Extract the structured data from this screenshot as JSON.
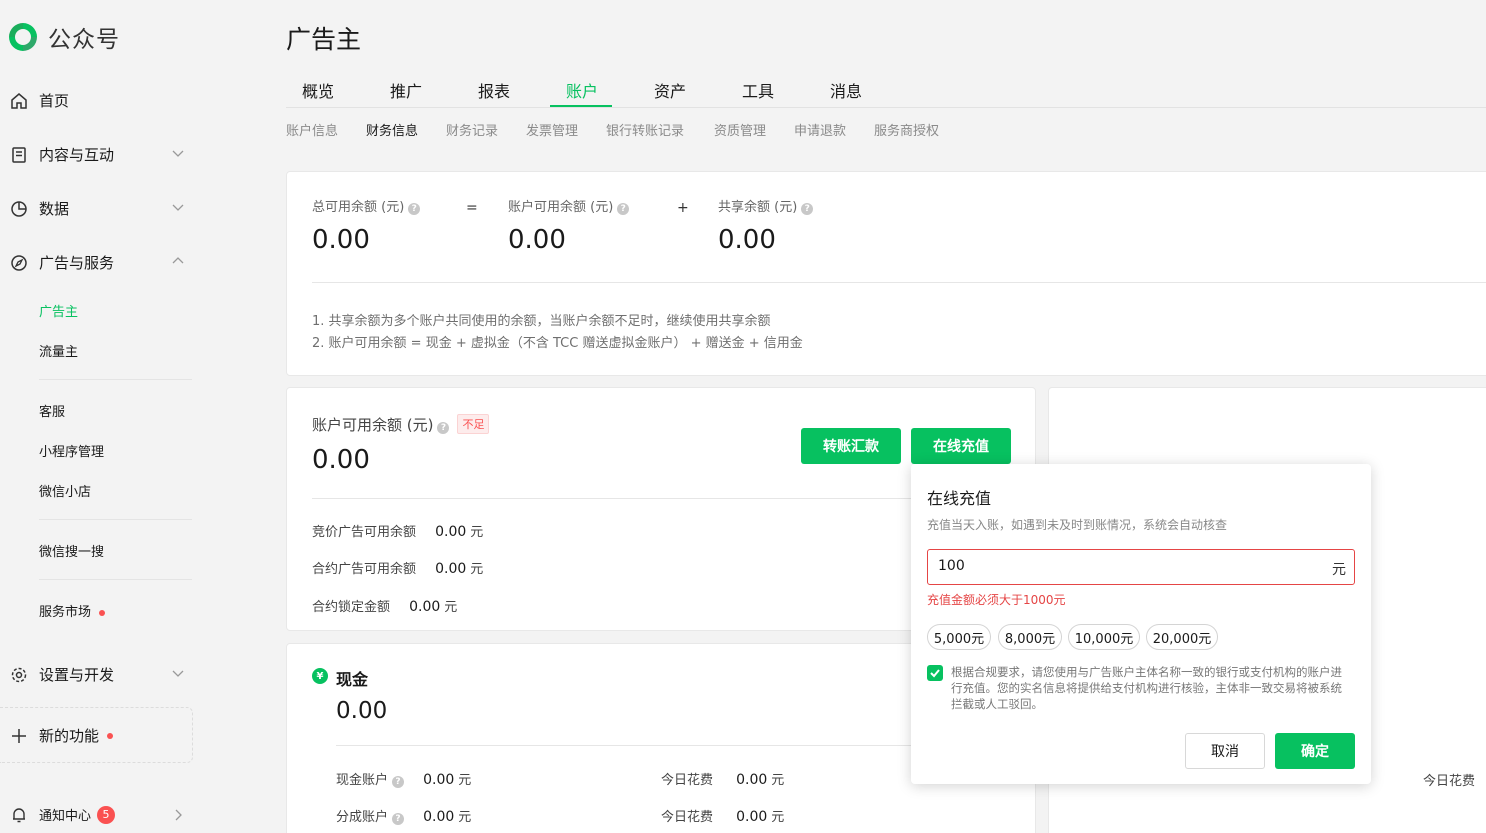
{
  "sidebar": {
    "logo_text": "公众号",
    "items": {
      "home": "首页",
      "content": "内容与互动",
      "data": "数据",
      "ads": "广告与服务",
      "settings": "设置与开发",
      "new_features": "新的功能",
      "notifications": "通知中心"
    },
    "ads_sub": [
      "广告主",
      "流量主"
    ],
    "group2": [
      "客服",
      "小程序管理",
      "微信小店"
    ],
    "group3": [
      "微信搜一搜"
    ],
    "group4": [
      "服务市场"
    ],
    "notification_count": "5"
  },
  "page": {
    "title": "广告主",
    "tabs": [
      "概览",
      "推广",
      "报表",
      "账户",
      "资产",
      "工具",
      "消息"
    ],
    "active_tab": "账户",
    "subtabs": [
      "账户信息",
      "财务信息",
      "财务记录",
      "发票管理",
      "银行转账记录",
      "资质管理",
      "申请退款",
      "服务商授权"
    ],
    "active_subtab": "财务信息"
  },
  "summary": {
    "total_label": "总可用余额 (元)",
    "total_value": "0.00",
    "equals": "=",
    "account_label": "账户可用余额 (元)",
    "account_value": "0.00",
    "plus": "+",
    "shared_label": "共享余额 (元)",
    "shared_value": "0.00",
    "note1": "1. 共享余额为多个账户共同使用的余额，当账户余额不足时，继续使用共享余额",
    "note2": "2. 账户可用余额 = 现金 + 虚拟金（不含 TCC 赠送虚拟金账户） + 赠送金 + 信用金"
  },
  "account_card": {
    "label": "账户可用余额 (元)",
    "tag": "不足",
    "value": "0.00",
    "transfer_button": "转账汇款",
    "recharge_button": "在线充值",
    "rows": [
      {
        "label": "竞价广告可用余额",
        "value": "0.00",
        "unit": "元"
      },
      {
        "label": "合约广告可用余额",
        "value": "0.00",
        "unit": "元"
      },
      {
        "label": "合约锁定金额",
        "value": "0.00",
        "unit": "元"
      }
    ]
  },
  "cash_card": {
    "icon_char": "¥",
    "title": "现金",
    "value": "0.00",
    "rows": [
      {
        "label": "现金账户",
        "value": "0.00",
        "unit": "元",
        "today_label": "今日花费",
        "today_value": "0.00",
        "today_unit": "元"
      },
      {
        "label": "分成账户",
        "value": "0.00",
        "unit": "元",
        "today_label": "今日花费",
        "today_value": "0.00",
        "today_unit": "元"
      }
    ],
    "right_today_label": "今日花费"
  },
  "recharge_popover": {
    "title": "在线充值",
    "desc": "充值当天入账，如遇到未及时到账情况，系统会自动核查",
    "amount_value": "100",
    "unit": "元",
    "error": "充值金额必须大于1000元",
    "quick_amounts": [
      "5,000元",
      "8,000元",
      "10,000元",
      "20,000元"
    ],
    "agreement": "根据合规要求，请您使用与广告账户主体名称一致的银行或支付机构的账户进行充值。您的实名信息将提供给支付机构进行核验，主体非一致交易将被系统拦截或人工驳回。",
    "agreement_checked": true,
    "cancel": "取消",
    "confirm": "确定"
  },
  "colors": {
    "accent": "#07c160",
    "error": "#e54545",
    "dot": "#fa5151"
  }
}
